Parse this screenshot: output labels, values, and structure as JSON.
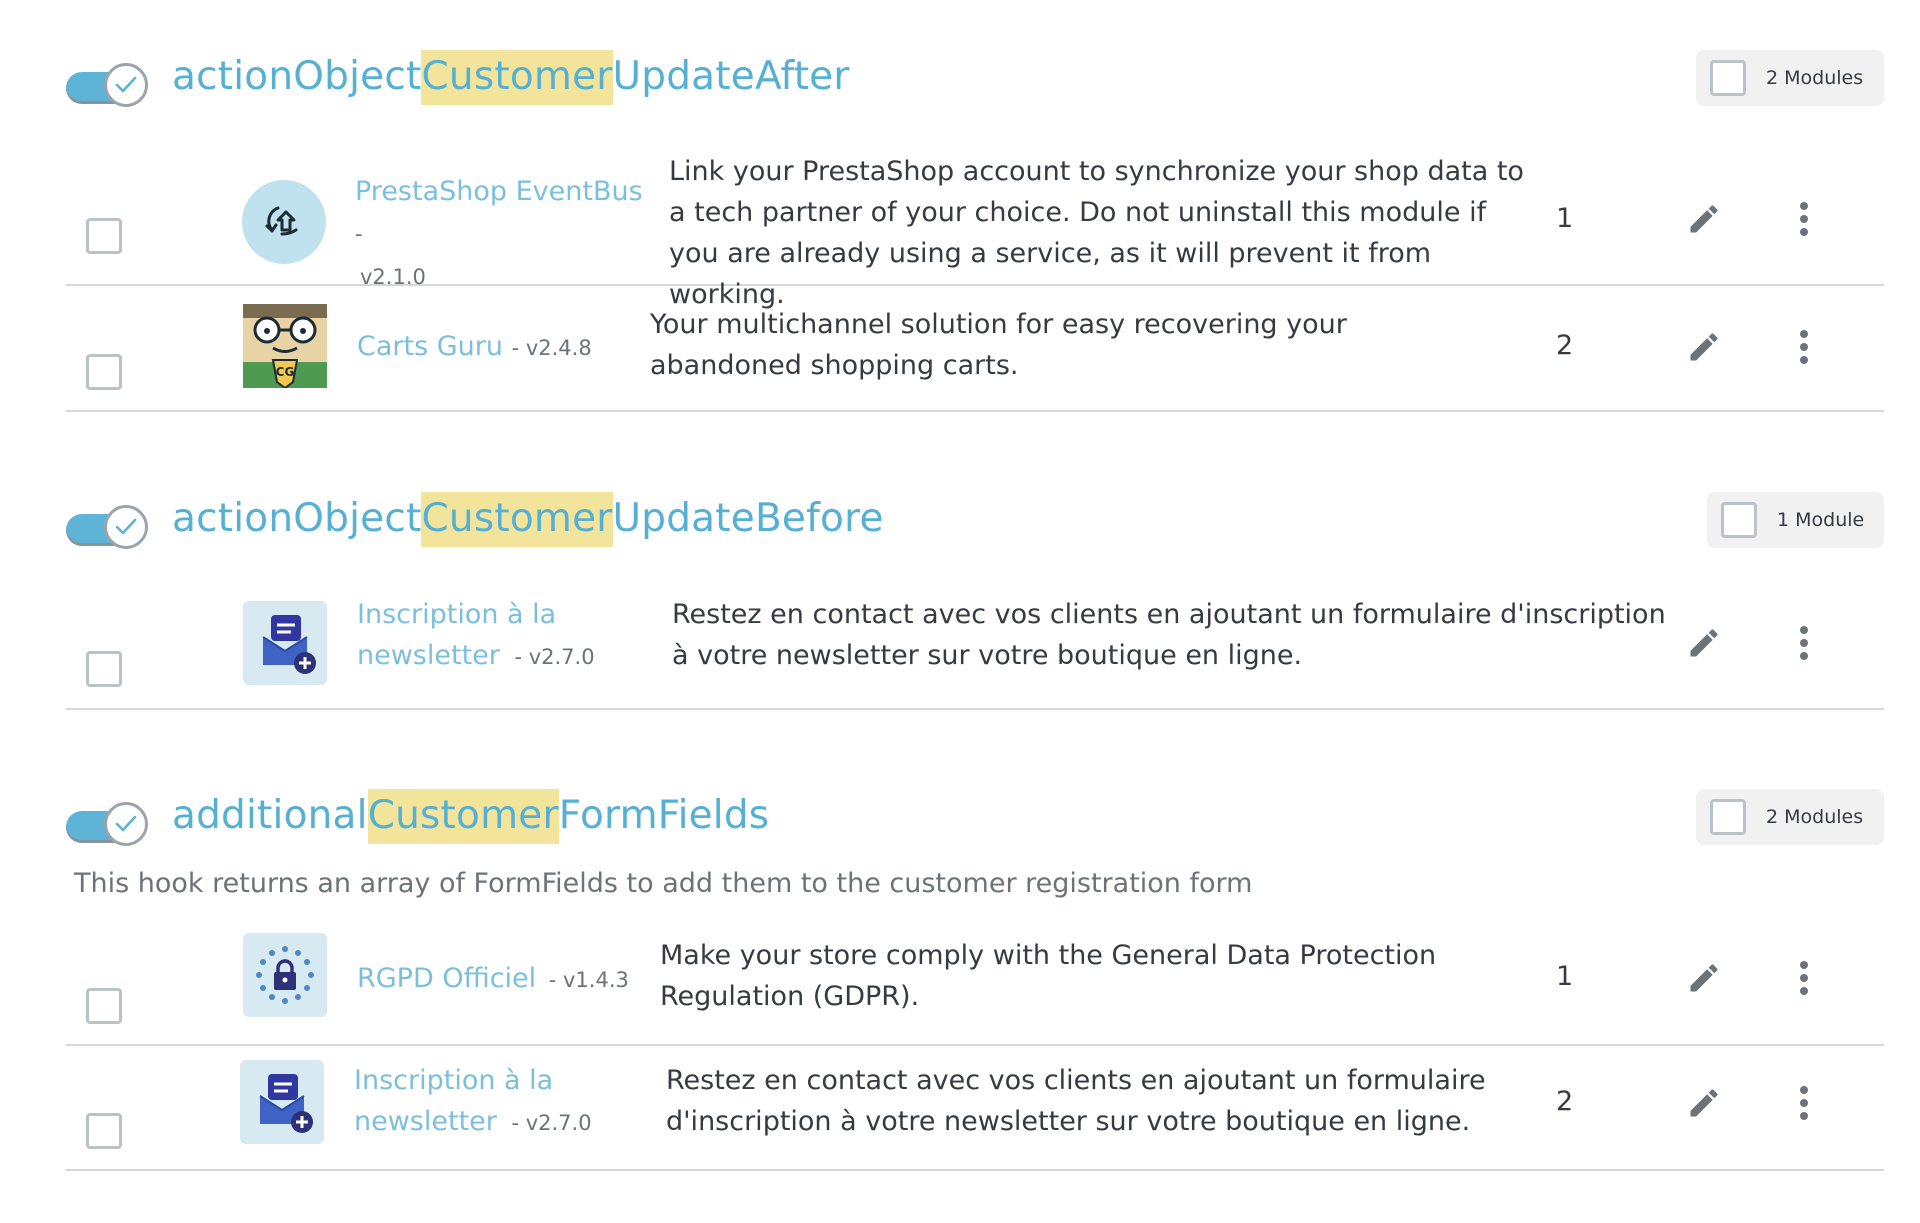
{
  "hooks": [
    {
      "title_prefix": "actionObject",
      "title_highlight": "Customer",
      "title_suffix": "UpdateAfter",
      "modules_label": "2 Modules",
      "rows": [
        {
          "logo": "eventbus-logo",
          "name": "PrestaShop EventBus",
          "name_separator": "-",
          "version": "v2.1.0",
          "description": "Link your PrestaShop account to synchronize your shop data to a tech partner of your choice. Do not uninstall this module if you are already using a service, as it will prevent it from working.",
          "position": "1"
        },
        {
          "logo": "carts-guru-logo",
          "name": "Carts Guru",
          "version": "- v2.4.8",
          "description": "Your multichannel solution for easy recovering your abandoned shopping carts.",
          "position": "2"
        }
      ]
    },
    {
      "title_prefix": "actionObject",
      "title_highlight": "Customer",
      "title_suffix": "UpdateBefore",
      "modules_label": "1 Module",
      "rows": [
        {
          "logo": "newsletter-logo",
          "name": "Inscription à la newsletter",
          "version": "- v2.7.0",
          "description": "Restez en contact avec vos clients en ajoutant un formulaire d'inscription à votre newsletter sur votre boutique en ligne.",
          "position": ""
        }
      ]
    },
    {
      "title_prefix": "additional",
      "title_highlight": "Customer",
      "title_suffix": "FormFields",
      "modules_label": "2 Modules",
      "description": "This hook returns an array of FormFields to add them to the customer registration form",
      "rows": [
        {
          "logo": "rgpd-logo",
          "name": "RGPD Officiel",
          "version": "- v1.4.3",
          "description": "Make your store comply with the General Data Protection Regulation (GDPR).",
          "position": "1"
        },
        {
          "logo": "newsletter-logo",
          "name": "Inscription à la newsletter",
          "version": "- v2.7.0",
          "description": "Restez en contact avec vos clients en ajoutant un formulaire d'inscription à votre newsletter sur votre boutique en ligne.",
          "position": "2"
        }
      ]
    }
  ],
  "colors": {
    "accent": "#55b0d4",
    "highlight": "#f3e49c",
    "toggle_on": "#5eb4d6",
    "divider": "#d4d8da"
  },
  "icons": {
    "toggle_check": "check-icon",
    "edit": "pencil-icon",
    "more": "kebab-icon"
  }
}
